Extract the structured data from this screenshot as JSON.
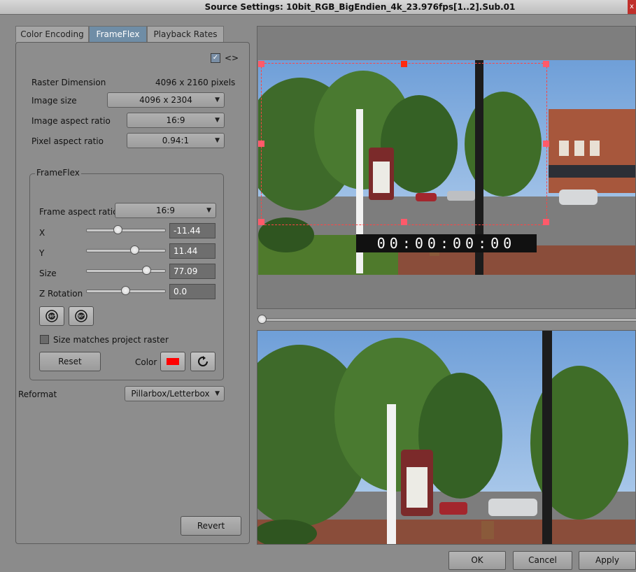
{
  "window": {
    "title": "Source Settings: 10bit_RGB_BigEndien_4k_23.976fps[1..2].Sub.01",
    "close_glyph": "x"
  },
  "tabs": [
    {
      "label": "Color Encoding",
      "active": false
    },
    {
      "label": "FrameFlex",
      "active": true
    },
    {
      "label": "Playback Rates",
      "active": false
    }
  ],
  "panel": {
    "toggle_glyph": "<>",
    "toggle_checked": true,
    "raster_dimension": {
      "label": "Raster Dimension",
      "value": "4096 x 2160 pixels"
    },
    "image_size": {
      "label": "Image size",
      "value": "4096 x 2304"
    },
    "image_aspect": {
      "label": "Image aspect ratio",
      "value": "16:9"
    },
    "pixel_aspect": {
      "label": "Pixel aspect ratio",
      "value": "0.94:1"
    }
  },
  "frameflex": {
    "group_title": "FrameFlex",
    "frame_aspect": {
      "label": "Frame aspect ratio",
      "value": "16:9"
    },
    "x": {
      "label": "X",
      "value": "-11.44",
      "slider_fraction": 0.4
    },
    "y": {
      "label": "Y",
      "value": "11.44",
      "slider_fraction": 0.62
    },
    "size": {
      "label": "Size",
      "value": "77.09",
      "slider_fraction": 0.77
    },
    "z_rotation": {
      "label": "Z Rotation",
      "value": "0.0",
      "slider_fraction": 0.5
    },
    "rotate_left_glyph": "-90°",
    "rotate_right_glyph": "90°",
    "size_matches": {
      "label": "Size matches project raster",
      "checked": false
    },
    "reset_label": "Reset",
    "color_label": "Color",
    "color_swatch": "#ff0000"
  },
  "reformat": {
    "label": "Reformat",
    "value": "Pillarbox/Letterbox"
  },
  "revert_label": "Revert",
  "viewer": {
    "timecode": "00:00:00:00",
    "scrub_fraction": 0.0,
    "crop_color": "#ff3b3b"
  },
  "buttons": {
    "ok": "OK",
    "cancel": "Cancel",
    "apply": "Apply"
  },
  "colors": {
    "active_tab": "#6f8da6",
    "background": "#8b8b8b"
  }
}
